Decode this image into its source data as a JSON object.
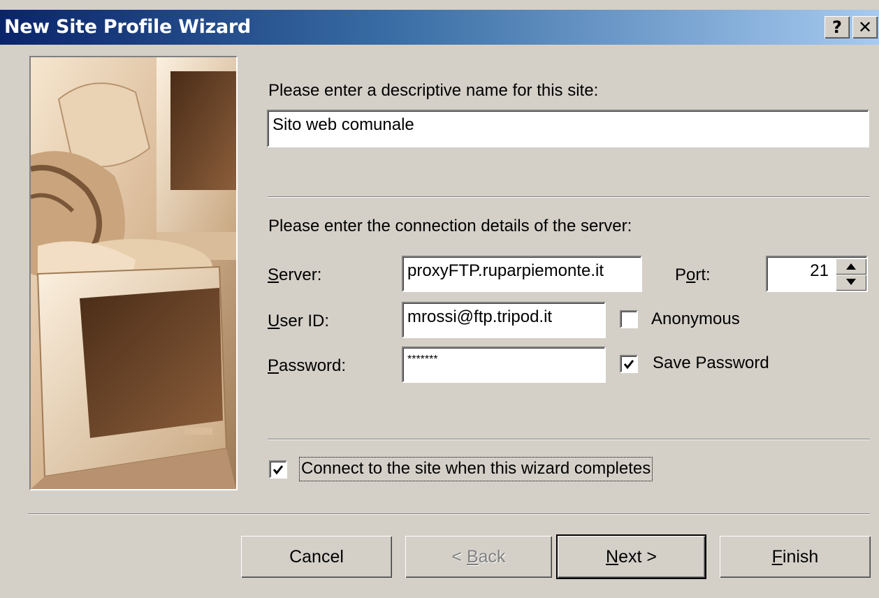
{
  "window": {
    "title": "New Site Profile Wizard",
    "help_glyph": "?",
    "close_glyph": "✕"
  },
  "site_name": {
    "prompt": "Please enter a descriptive name for this site:",
    "value": "Sito web comunale"
  },
  "connection": {
    "prompt": "Please enter the connection details of the server:",
    "server": {
      "label_access": "S",
      "label_rest": "erver:",
      "value": "proxyFTP.ruparpiemonte.it"
    },
    "port": {
      "label_pre": "P",
      "label_access": "o",
      "label_rest": "rt:",
      "value": "21"
    },
    "user_id": {
      "label_access": "U",
      "label_rest": "ser ID:",
      "value": "mrossi@ftp.tripod.it"
    },
    "password": {
      "label_access": "P",
      "label_rest": "assword:",
      "value": "*******"
    },
    "anonymous": {
      "label": "Anonymous",
      "checked": false
    },
    "save_password": {
      "label": "Save Password",
      "checked": true
    }
  },
  "connect_on_complete": {
    "label": "Connect to the site when this wizard completes",
    "checked": true
  },
  "buttons": {
    "cancel": "Cancel",
    "back_pre": "< ",
    "back_access": "B",
    "back_rest": "ack",
    "next_access": "N",
    "next_rest": "ext >",
    "finish_access": "F",
    "finish_rest": "inish"
  },
  "icons": {
    "wizard_image": "computer-monitors-illustration",
    "help": "help-icon",
    "close": "close-icon"
  },
  "colors": {
    "titlebar_start": "#0a246a",
    "titlebar_end": "#a6caf0",
    "dialog_face": "#d4d0c8"
  }
}
